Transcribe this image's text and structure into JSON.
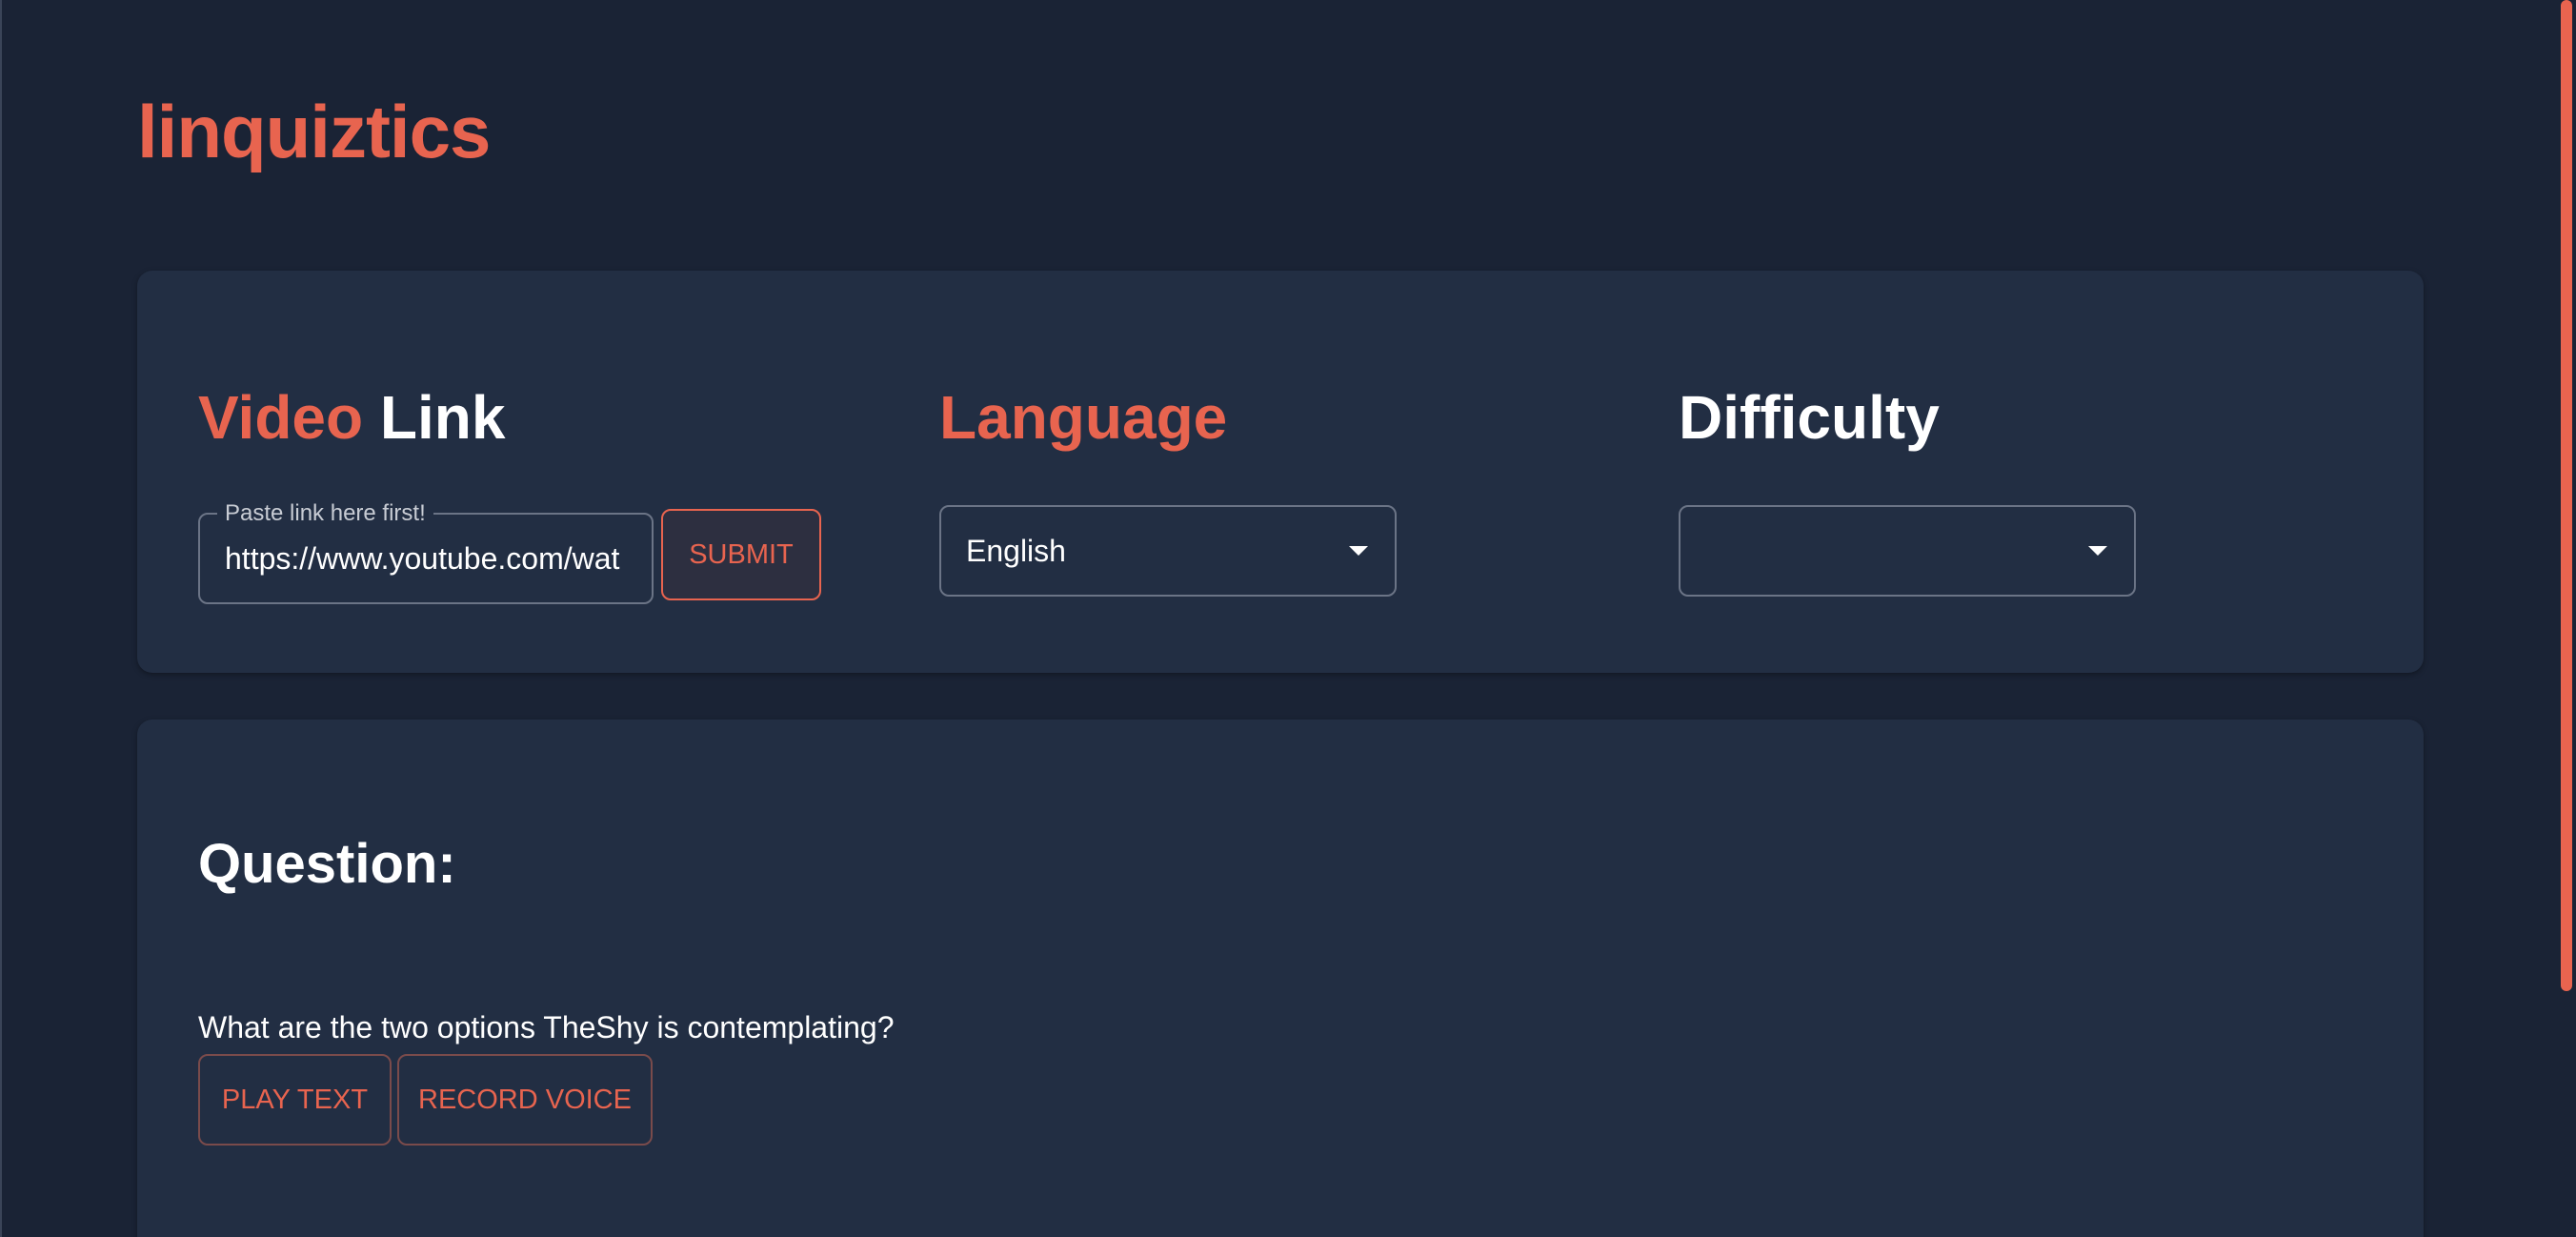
{
  "app": {
    "title": "linquiztics"
  },
  "settings": {
    "video_heading_accent": "Video",
    "video_heading_rest": "Link",
    "link_field": {
      "label": "Paste link here first!",
      "value": "https://www.youtube.com/wat"
    },
    "submit_label": "SUBMIT",
    "language_heading": "Language",
    "language_select": {
      "value": "English"
    },
    "difficulty_heading": "Difficulty",
    "difficulty_select": {
      "value": ""
    }
  },
  "question": {
    "heading": "Question:",
    "text": "What are the two options TheShy is contemplating?",
    "play_text_label": "PLAY TEXT",
    "record_voice_label": "RECORD VOICE"
  },
  "colors": {
    "accent": "#e8644f",
    "background": "#1a2335",
    "card": "#222e43"
  }
}
